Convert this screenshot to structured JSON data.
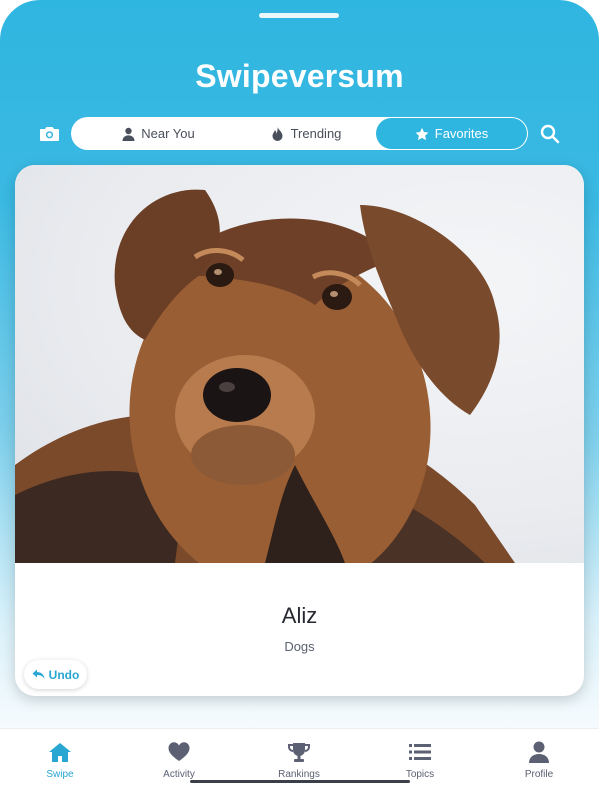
{
  "app": {
    "title": "Swipeversum"
  },
  "header": {
    "camera_icon": "camera-icon",
    "search_icon": "search-icon",
    "tabs": [
      {
        "label": "Near You",
        "icon": "person-icon",
        "active": false
      },
      {
        "label": "Trending",
        "icon": "flame-icon",
        "active": false
      },
      {
        "label": "Favorites",
        "icon": "star-icon",
        "active": true
      }
    ]
  },
  "card": {
    "name": "Aliz",
    "category": "Dogs",
    "undo_label": "Undo"
  },
  "bottom_nav": {
    "items": [
      {
        "label": "Swipe",
        "icon": "home-icon",
        "active": true
      },
      {
        "label": "Activity",
        "icon": "heart-icon",
        "active": false
      },
      {
        "label": "Rankings",
        "icon": "trophy-icon",
        "active": false
      },
      {
        "label": "Topics",
        "icon": "list-icon",
        "active": false
      },
      {
        "label": "Profile",
        "icon": "profile-icon",
        "active": false
      }
    ]
  },
  "colors": {
    "accent": "#2fb6e0",
    "accent_text": "#2aa6d3",
    "nav_inactive": "#5b6072"
  }
}
